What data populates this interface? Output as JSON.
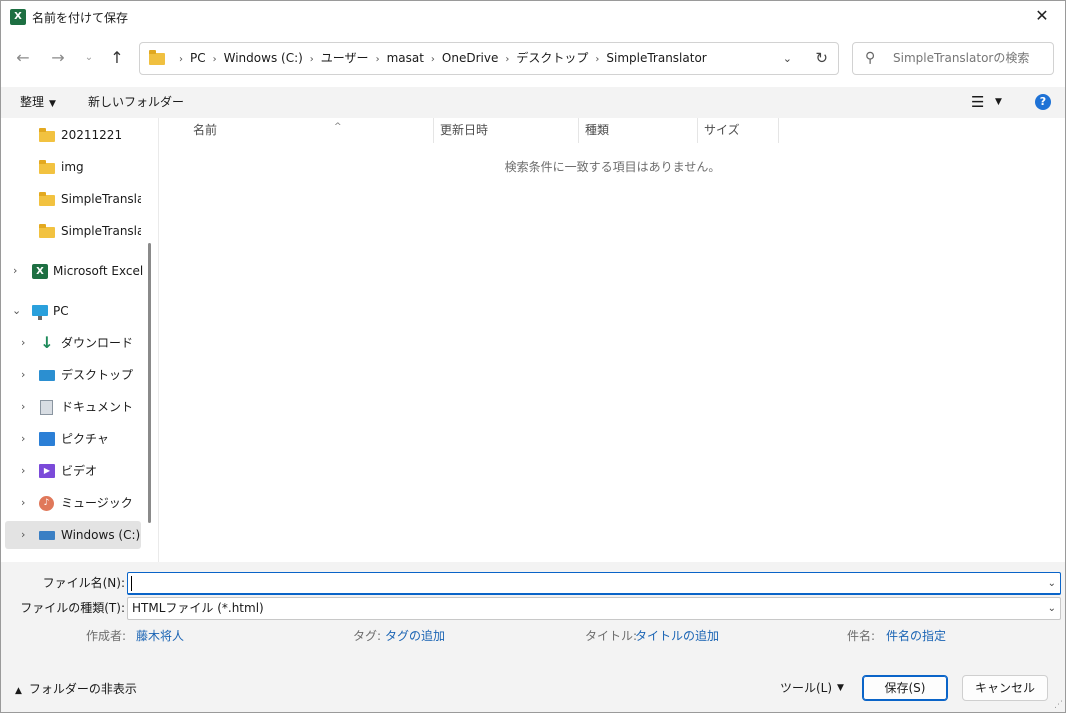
{
  "window": {
    "title": "名前を付けて保存",
    "app_icon_letter": "X",
    "close_glyph": "✕"
  },
  "nav": {
    "back_glyph": "←",
    "forward_glyph": "→",
    "recent_glyph": "⌄",
    "up_glyph": "↑"
  },
  "address": {
    "crumbs": [
      "PC",
      "Windows (C:)",
      "ユーザー",
      "masat",
      "OneDrive",
      "デスクトップ",
      "SimpleTranslator"
    ],
    "separator": "›",
    "dropdown_glyph": "⌄",
    "refresh_glyph": "↻"
  },
  "search": {
    "placeholder": "SimpleTranslatorの検索",
    "icon_glyph": "⚲"
  },
  "commandbar": {
    "organize_label": "整理",
    "organize_caret": "▼",
    "new_folder_label": "新しいフォルダー",
    "view_glyph": "☰",
    "view_caret": "▼",
    "help_glyph": "?"
  },
  "sidebar": {
    "chevron_right": "›",
    "chevron_down": "⌄",
    "items": [
      {
        "label": "20211221",
        "icon": "folder-icon"
      },
      {
        "label": "img",
        "icon": "folder-icon"
      },
      {
        "label": "SimpleTranslator",
        "icon": "folder-icon"
      },
      {
        "label": "SimpleTranslator",
        "icon": "folder-icon"
      },
      {
        "label": "Microsoft Excel",
        "icon": "excel-icon"
      },
      {
        "label": "PC",
        "icon": "pc-icon"
      },
      {
        "label": "ダウンロード",
        "icon": "download-icon"
      },
      {
        "label": "デスクトップ",
        "icon": "desktop-icon"
      },
      {
        "label": "ドキュメント",
        "icon": "document-icon"
      },
      {
        "label": "ピクチャ",
        "icon": "pictures-icon"
      },
      {
        "label": "ビデオ",
        "icon": "video-icon"
      },
      {
        "label": "ミュージック",
        "icon": "music-icon"
      },
      {
        "label": "Windows (C:)",
        "icon": "drive-icon"
      }
    ]
  },
  "filelist": {
    "columns": [
      "名前",
      "更新日時",
      "種類",
      "サイズ"
    ],
    "sort_glyph": "^",
    "empty_message": "検索条件に一致する項目はありません。"
  },
  "form": {
    "filename_label": "ファイル名(N):",
    "filename_value": "",
    "filetype_label": "ファイルの種類(T):",
    "filetype_value": "HTMLファイル (*.html)",
    "dropdown_glyph": "⌄",
    "author_label": "作成者:",
    "author_value": "藤木将人",
    "tags_label": "タグ:",
    "tags_value": "タグの追加",
    "title_label": "タイトル:",
    "title_value": "タイトルの追加",
    "subject_label": "件名:",
    "subject_value": "件名の指定"
  },
  "footer": {
    "hide_folders_caret": "▲",
    "hide_folders_label": "フォルダーの非表示",
    "tools_label": "ツール(L)",
    "tools_caret": "▼",
    "save_label": "保存(S)",
    "cancel_label": "キャンセル",
    "grip_glyph": "⋰"
  },
  "colors": {
    "accent": "#0a64c8",
    "link": "#1a64b4",
    "excel_green": "#1d6f42",
    "folder_yellow": "#f2c240"
  }
}
